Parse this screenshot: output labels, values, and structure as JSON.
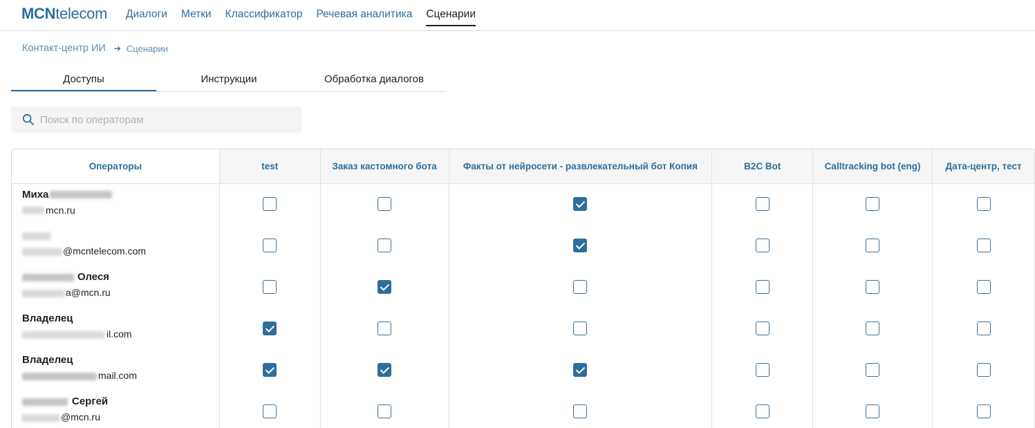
{
  "header": {
    "logo_bold": "MCN",
    "logo_rest": "telecom",
    "nav": [
      {
        "label": "Диалоги",
        "active": false
      },
      {
        "label": "Метки",
        "active": false
      },
      {
        "label": "Классификатор",
        "active": false
      },
      {
        "label": "Речевая аналитика",
        "active": false
      },
      {
        "label": "Сценарии",
        "active": true
      }
    ]
  },
  "breadcrumb": {
    "root": "Контакт-центр ИИ",
    "current": "Сценарии"
  },
  "tabs": [
    {
      "label": "Доступы",
      "active": true
    },
    {
      "label": "Инструкции",
      "active": false
    },
    {
      "label": "Обработка диалогов",
      "active": false
    }
  ],
  "search": {
    "placeholder": "Поиск по операторам",
    "value": ""
  },
  "table": {
    "columns": [
      "Операторы",
      "test",
      "Заказ кастомного бота",
      "Факты от нейросети - развлекательный бот Копия",
      "B2C Bot",
      "Calltracking bot (eng)",
      "Дата-центр, тест"
    ],
    "rows": [
      {
        "name": "Миха",
        "email": "mcn.ru",
        "access": [
          false,
          false,
          true,
          false,
          false,
          false
        ]
      },
      {
        "name": "",
        "email": "@mcntelecom.com",
        "access": [
          false,
          false,
          true,
          false,
          false,
          false
        ]
      },
      {
        "name": "Олеся",
        "email": "a@mcn.ru",
        "access": [
          false,
          true,
          false,
          false,
          false,
          false
        ]
      },
      {
        "name": "Владелец",
        "email": "il.com",
        "access": [
          true,
          false,
          false,
          false,
          false,
          false
        ]
      },
      {
        "name": "Владелец",
        "email": "mail.com",
        "access": [
          true,
          true,
          true,
          false,
          false,
          false
        ]
      },
      {
        "name": "Сергей",
        "email": "@mcn.ru",
        "access": [
          false,
          false,
          false,
          false,
          false,
          false
        ]
      }
    ]
  },
  "colors": {
    "accent": "#2d6e9c",
    "header_bg": "#f5f5f5",
    "border": "#e2e2e2"
  }
}
